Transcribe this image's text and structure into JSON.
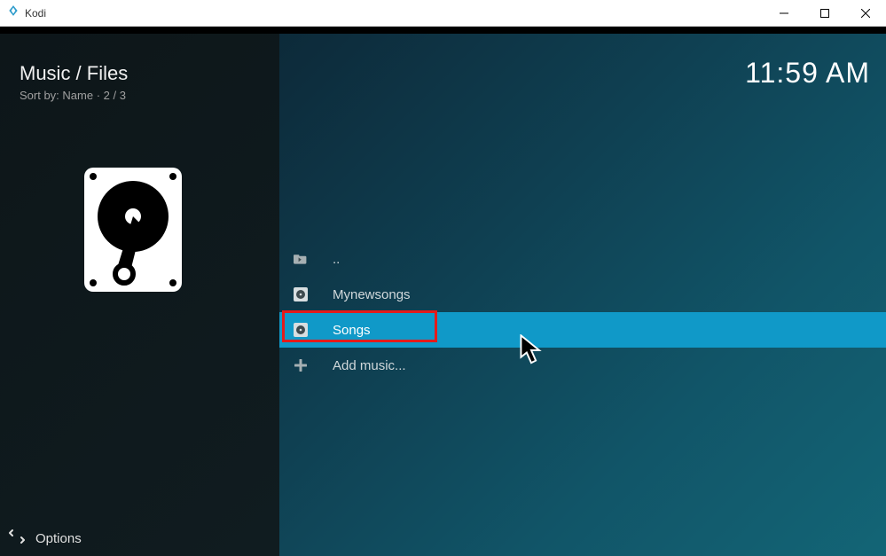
{
  "window": {
    "title": "Kodi"
  },
  "header": {
    "breadcrumb": "Music / Files",
    "sort_info": "Sort by: Name  ·  2 / 3",
    "clock": "11:59 AM"
  },
  "list": {
    "items": [
      {
        "label": "..",
        "icon": "back-folder",
        "selected": false
      },
      {
        "label": "Mynewsongs",
        "icon": "disc",
        "selected": false
      },
      {
        "label": "Songs",
        "icon": "disc",
        "selected": true
      },
      {
        "label": "Add music...",
        "icon": "plus",
        "selected": false
      }
    ]
  },
  "footer": {
    "options_label": "Options"
  }
}
